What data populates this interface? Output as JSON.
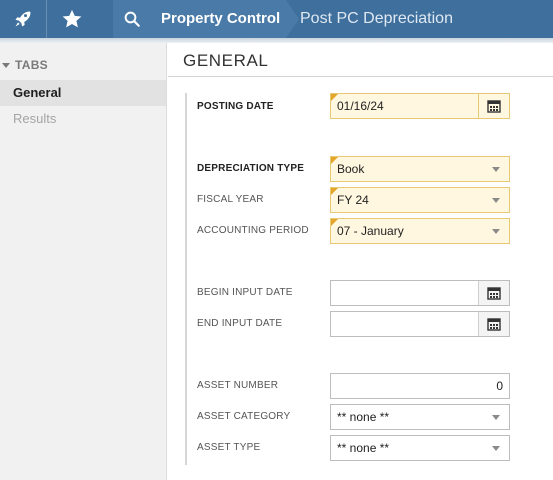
{
  "header": {
    "app_icon": "rocket-icon",
    "favorites_icon": "star-icon",
    "search_icon": "search-icon",
    "breadcrumb": [
      "Property Control",
      "Post PC Depreciation"
    ]
  },
  "sidebar": {
    "header": "TABS",
    "items": [
      {
        "label": "General",
        "active": true
      },
      {
        "label": "Results",
        "active": false
      }
    ]
  },
  "main": {
    "section_title": "GENERAL",
    "fields": {
      "posting_date": {
        "label": "POSTING DATE",
        "value": "01/16/24",
        "required": true
      },
      "depreciation_type": {
        "label": "DEPRECIATION TYPE",
        "value": "Book",
        "required": true
      },
      "fiscal_year": {
        "label": "FISCAL YEAR",
        "value": "FY 24",
        "required": true
      },
      "accounting_period": {
        "label": "ACCOUNTING PERIOD",
        "value": "07 - January",
        "required": true
      },
      "begin_input_date": {
        "label": "BEGIN INPUT DATE",
        "value": ""
      },
      "end_input_date": {
        "label": "END INPUT DATE",
        "value": ""
      },
      "asset_number": {
        "label": "ASSET NUMBER",
        "value": "0"
      },
      "asset_category": {
        "label": "ASSET CATEGORY",
        "value": "** none **"
      },
      "asset_type": {
        "label": "ASSET TYPE",
        "value": "** none **"
      }
    }
  },
  "colors": {
    "header_bg": "#3f6f9c",
    "required_bg": "#fff7df",
    "required_marker": "#e3a62b"
  }
}
